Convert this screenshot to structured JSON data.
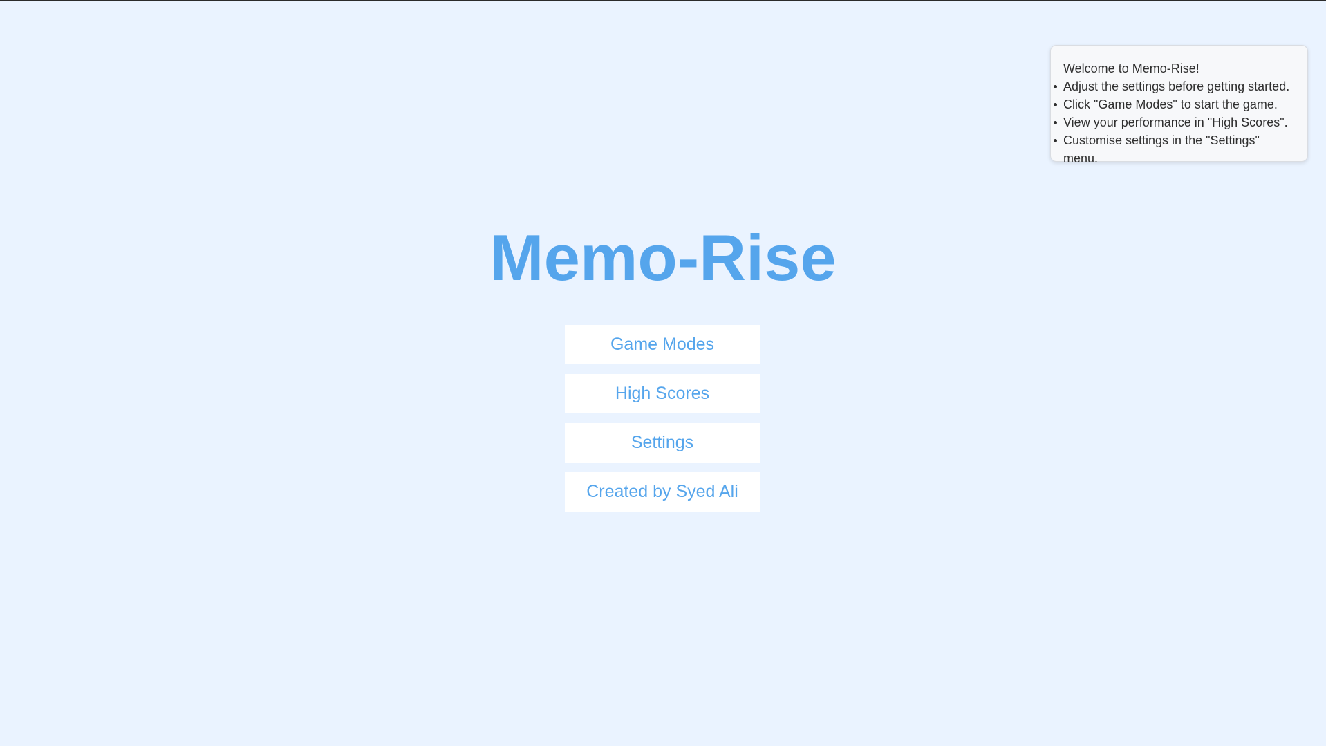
{
  "app": {
    "title": "Memo-Rise"
  },
  "menu": {
    "items": [
      {
        "label": "Game Modes"
      },
      {
        "label": "High Scores"
      },
      {
        "label": "Settings"
      },
      {
        "label": "Created by Syed Ali"
      }
    ]
  },
  "help": {
    "heading": "Welcome to Memo-Rise!",
    "tips": [
      "Adjust the settings before getting started.",
      "Click \"Game Modes\" to start the game.",
      "View your performance in \"High Scores\".",
      "Customise settings in the \"Settings\" menu."
    ]
  },
  "colors": {
    "background": "#eaf3ff",
    "accent": "#55a5ec",
    "button_bg": "#ffffff",
    "panel_bg": "#f7f8fa"
  }
}
